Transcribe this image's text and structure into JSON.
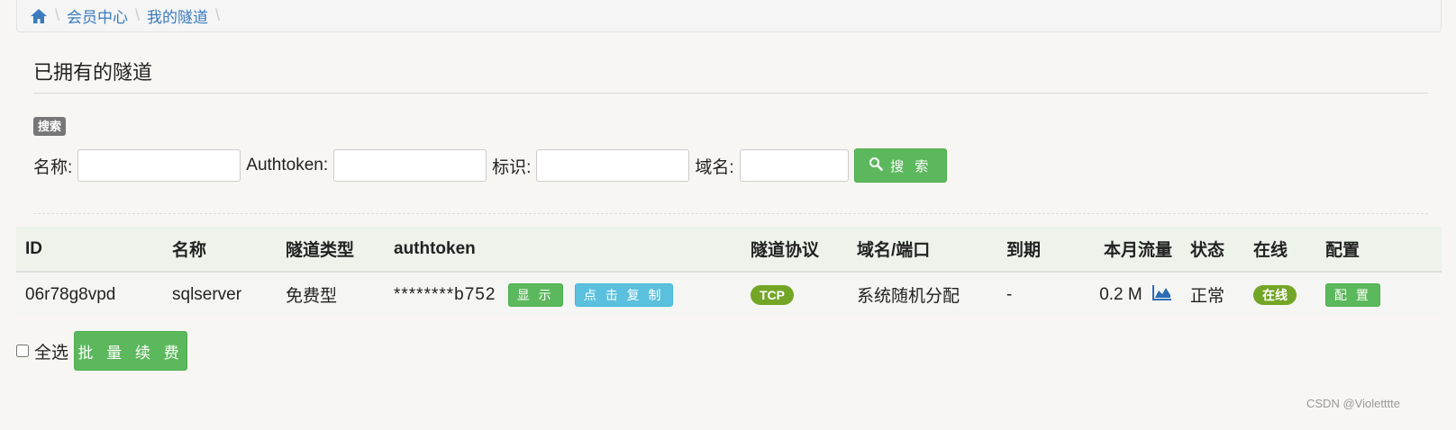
{
  "breadcrumb": {
    "items": [
      "会员中心",
      "我的隧道"
    ]
  },
  "page": {
    "title": "已拥有的隧道"
  },
  "search": {
    "badge": "搜索",
    "name_label": "名称:",
    "authtoken_label": "Authtoken:",
    "tag_label": "标识:",
    "domain_label": "域名:",
    "button_label": "搜 索"
  },
  "table": {
    "headers": [
      "ID",
      "名称",
      "隧道类型",
      "authtoken",
      "隧道协议",
      "域名/端口",
      "到期",
      "本月流量",
      "状态",
      "在线",
      "配置"
    ],
    "rows": [
      {
        "id": "06r78g8vpd",
        "name": "sqlserver",
        "type": "免费型",
        "authtoken": "********b752",
        "show_label": "显 示",
        "copy_label": "点 击 复 制",
        "protocol": "TCP",
        "domain_port": "系统随机分配",
        "expiry": "-",
        "traffic": "0.2 M",
        "status": "正常",
        "online": "在线",
        "config_label": "配 置"
      }
    ]
  },
  "footer": {
    "select_all_label": "全选",
    "renew_label": "批 量 续 费"
  },
  "watermark": "CSDN @Violetttte",
  "colors": {
    "link": "#3a7bbd",
    "success": "#5cb85c",
    "info": "#5bc0de",
    "badge_green": "#73a526"
  }
}
